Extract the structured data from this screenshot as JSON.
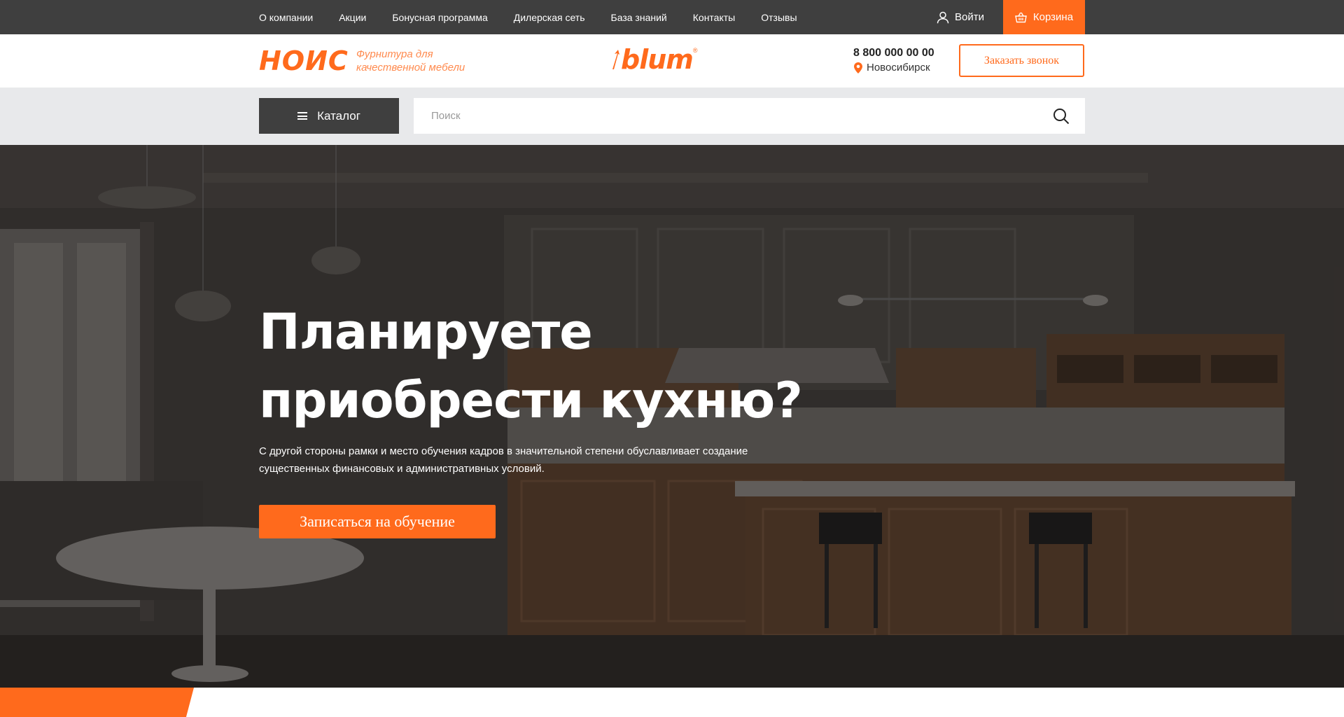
{
  "topbar": {
    "nav": [
      "О компании",
      "Акции",
      "Бонусная программа",
      "Дилерская сеть",
      "База знаний",
      "Контакты",
      "Отзывы"
    ],
    "login_label": "Войти",
    "cart_label": "Корзина",
    "icons": {
      "login": "user-icon",
      "cart": "basket-icon"
    }
  },
  "header": {
    "brand": "НОИС",
    "tagline_line1": "Фурнитура для",
    "tagline_line2": "качественной мебели",
    "partner_logo": "blum",
    "partner_reg": "®",
    "phone": "8 800 000 00 00",
    "city": "Новосибирск",
    "callback_label": "Заказать звонок"
  },
  "search": {
    "catalog_label": "Каталог",
    "placeholder": "Поиск"
  },
  "hero": {
    "title_line1": "Планируете",
    "title_line2": "приобрести кухню?",
    "text": "С другой стороны рамки и место обучения кадров в значительной степени обуславливает создание существенных финансовых и административных условий.",
    "button_label": "Записаться на обучение"
  },
  "colors": {
    "accent": "#ff6a1c",
    "dark": "#3f3f3f",
    "band": "#e8e9eb"
  }
}
